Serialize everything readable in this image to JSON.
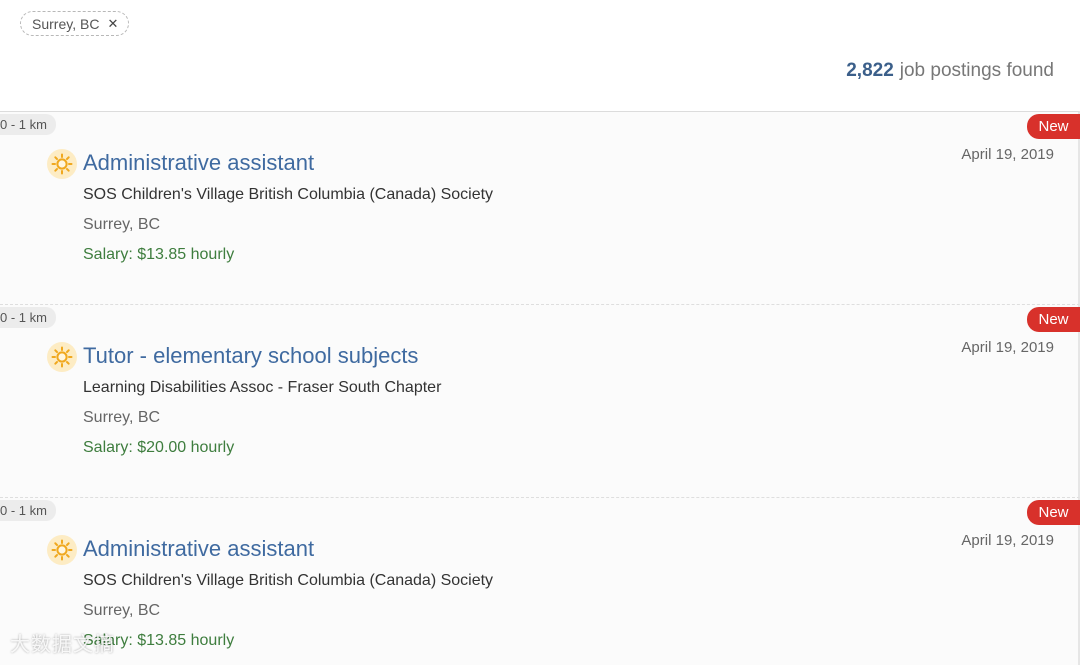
{
  "filters": {
    "chip_label": "Surrey, BC",
    "chip_close": "✕"
  },
  "results": {
    "count": "2,822",
    "count_suffix": "job postings found"
  },
  "jobs": [
    {
      "distance": "0 - 1 km",
      "new_label": "New",
      "date": "April 19, 2019",
      "title": "Administrative assistant",
      "employer": "SOS Children's Village British Columbia (Canada) Society",
      "location": "Surrey, BC",
      "salary": "Salary: $13.85 hourly",
      "icon": "sun-icon"
    },
    {
      "distance": "0 - 1 km",
      "new_label": "New",
      "date": "April 19, 2019",
      "title": "Tutor - elementary school subjects",
      "employer": "Learning Disabilities Assoc - Fraser South Chapter",
      "location": "Surrey, BC",
      "salary": "Salary: $20.00 hourly",
      "icon": "sun-icon"
    },
    {
      "distance": "0 - 1 km",
      "new_label": "New",
      "date": "April 19, 2019",
      "title": "Administrative assistant",
      "employer": "SOS Children's Village British Columbia (Canada) Society",
      "location": "Surrey, BC",
      "salary": "Salary: $13.85 hourly",
      "icon": "sun-icon"
    }
  ],
  "watermark": "大数据文摘",
  "colors": {
    "title": "#3f6aa0",
    "salary": "#3e7d3e",
    "new_badge": "#d8312b",
    "count": "#3b5f8a",
    "sun": "#f0a81e"
  }
}
